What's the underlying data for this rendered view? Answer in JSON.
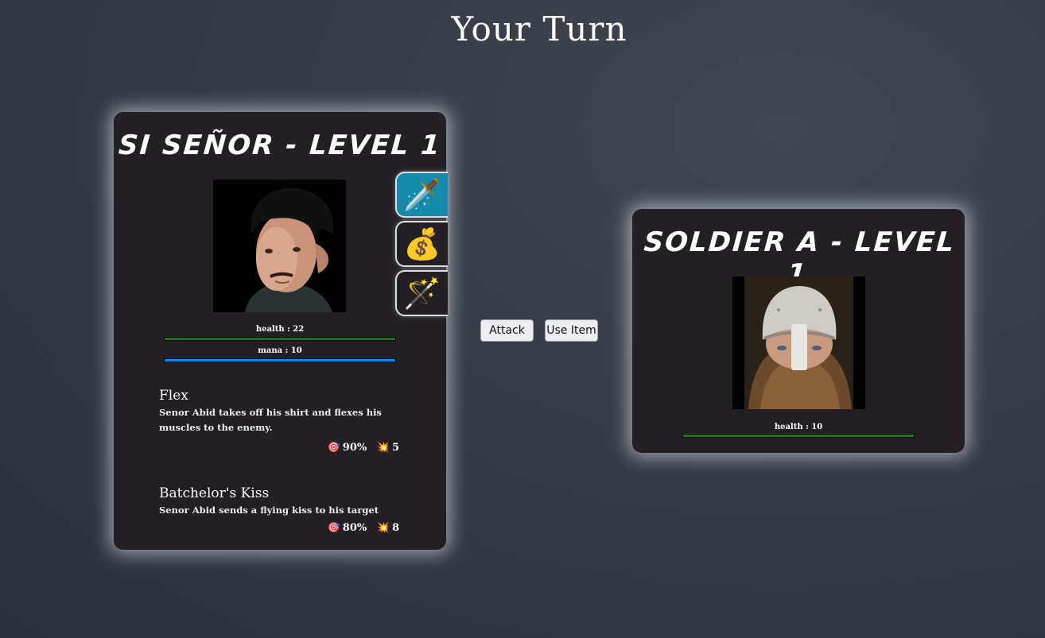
{
  "header": {
    "title": "Your Turn"
  },
  "player": {
    "name_level": "SI SEÑOR - LEVEL 1",
    "health_label": "health : 22",
    "mana_label": "mana : 10",
    "health_fraction": 1.0,
    "mana_fraction": 1.0,
    "tabs": [
      {
        "icon": "sword-icon",
        "glyph": "🗡️",
        "active": true
      },
      {
        "icon": "money-bag-icon",
        "glyph": "💰",
        "active": false
      },
      {
        "icon": "magic-wand-icon",
        "glyph": "🪄",
        "active": false
      }
    ],
    "moves": [
      {
        "name": "Flex",
        "description": "Senor Abid takes off his shirt and flexes his muscles to the enemy.",
        "accuracy_icon": "🎯",
        "accuracy": "90%",
        "damage_icon": "💥",
        "damage": "5"
      },
      {
        "name": "Batchelor's Kiss",
        "description": "Senor Abid sends a flying kiss to his target",
        "accuracy_icon": "🎯",
        "accuracy": "80%",
        "damage_icon": "💥",
        "damage": "8"
      }
    ]
  },
  "actions": {
    "attack_label": "Attack",
    "use_item_label": "Use Item"
  },
  "enemy": {
    "name_level": "SOLDIER A - LEVEL 1",
    "health_label": "health : 10",
    "health_fraction": 1.0
  },
  "colors": {
    "health_bar": "#137a1f",
    "mana_bar": "#1a8ad8",
    "active_tab": "#168aad",
    "card_bg": "#231f24"
  }
}
